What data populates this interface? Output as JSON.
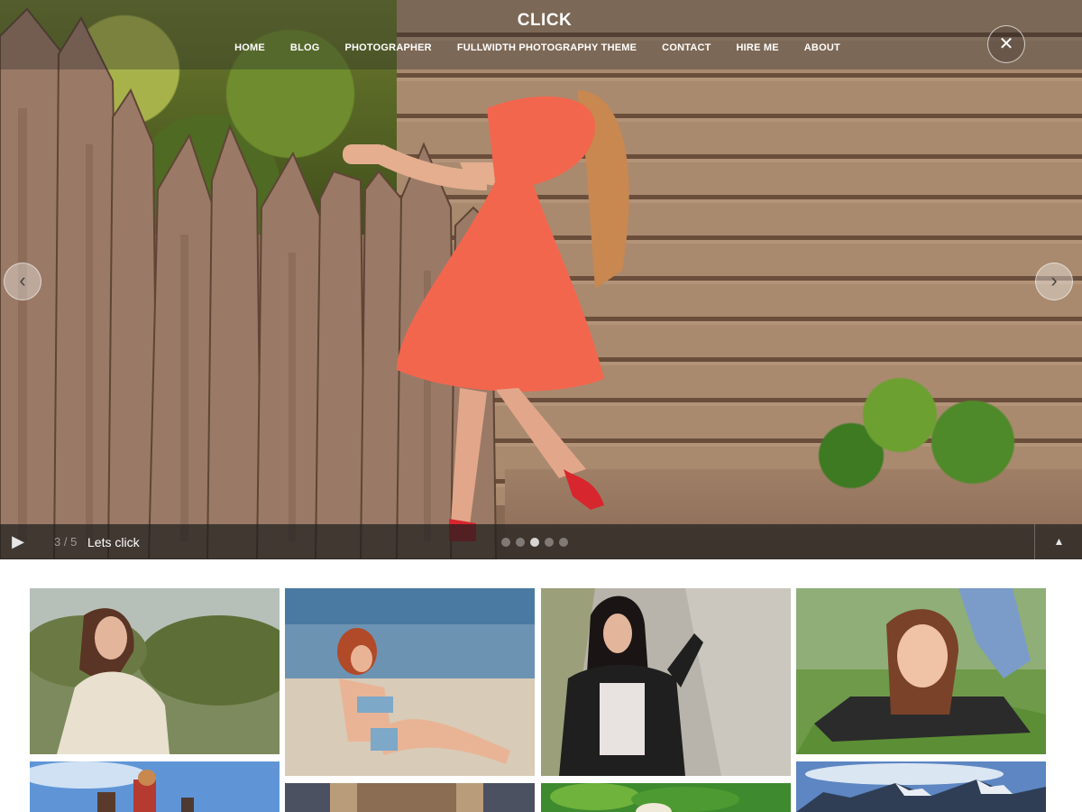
{
  "site": {
    "title": "CLICK"
  },
  "nav": {
    "items": [
      {
        "label": "HOME"
      },
      {
        "label": "BLOG"
      },
      {
        "label": "PHOTOGRAPHER"
      },
      {
        "label": "FULLWIDTH PHOTOGRAPHY THEME"
      },
      {
        "label": "CONTACT"
      },
      {
        "label": "HIRE ME"
      },
      {
        "label": "ABOUT"
      }
    ]
  },
  "icons": {
    "close": "close-icon",
    "prev": "chevron-left-icon",
    "next": "chevron-right-icon",
    "play": "play-icon",
    "toggle": "caret-up-icon"
  },
  "slider": {
    "current_slide": "3",
    "total_slides": "5",
    "counter_text": "3 / 5",
    "caption": "Lets click",
    "dots": [
      {},
      {},
      {},
      {},
      {}
    ]
  },
  "gallery": {
    "photos": [
      {
        "desc": "woman-in-shawl-outdoors"
      },
      {
        "desc": "vintage-beach-pinup"
      },
      {
        "desc": "woman-leather-jacket-rock-wall"
      },
      {
        "desc": "woman-lying-in-grass"
      },
      {
        "desc": "people-under-blue-sky"
      },
      {
        "desc": "long-hair-back-view"
      },
      {
        "desc": "green-foliage"
      },
      {
        "desc": "snowy-mountains"
      }
    ]
  },
  "colors": {
    "overlay": "#282828",
    "caption_text": "#ffffff",
    "dress": "#f2664e",
    "shoes": "#d8262e"
  }
}
